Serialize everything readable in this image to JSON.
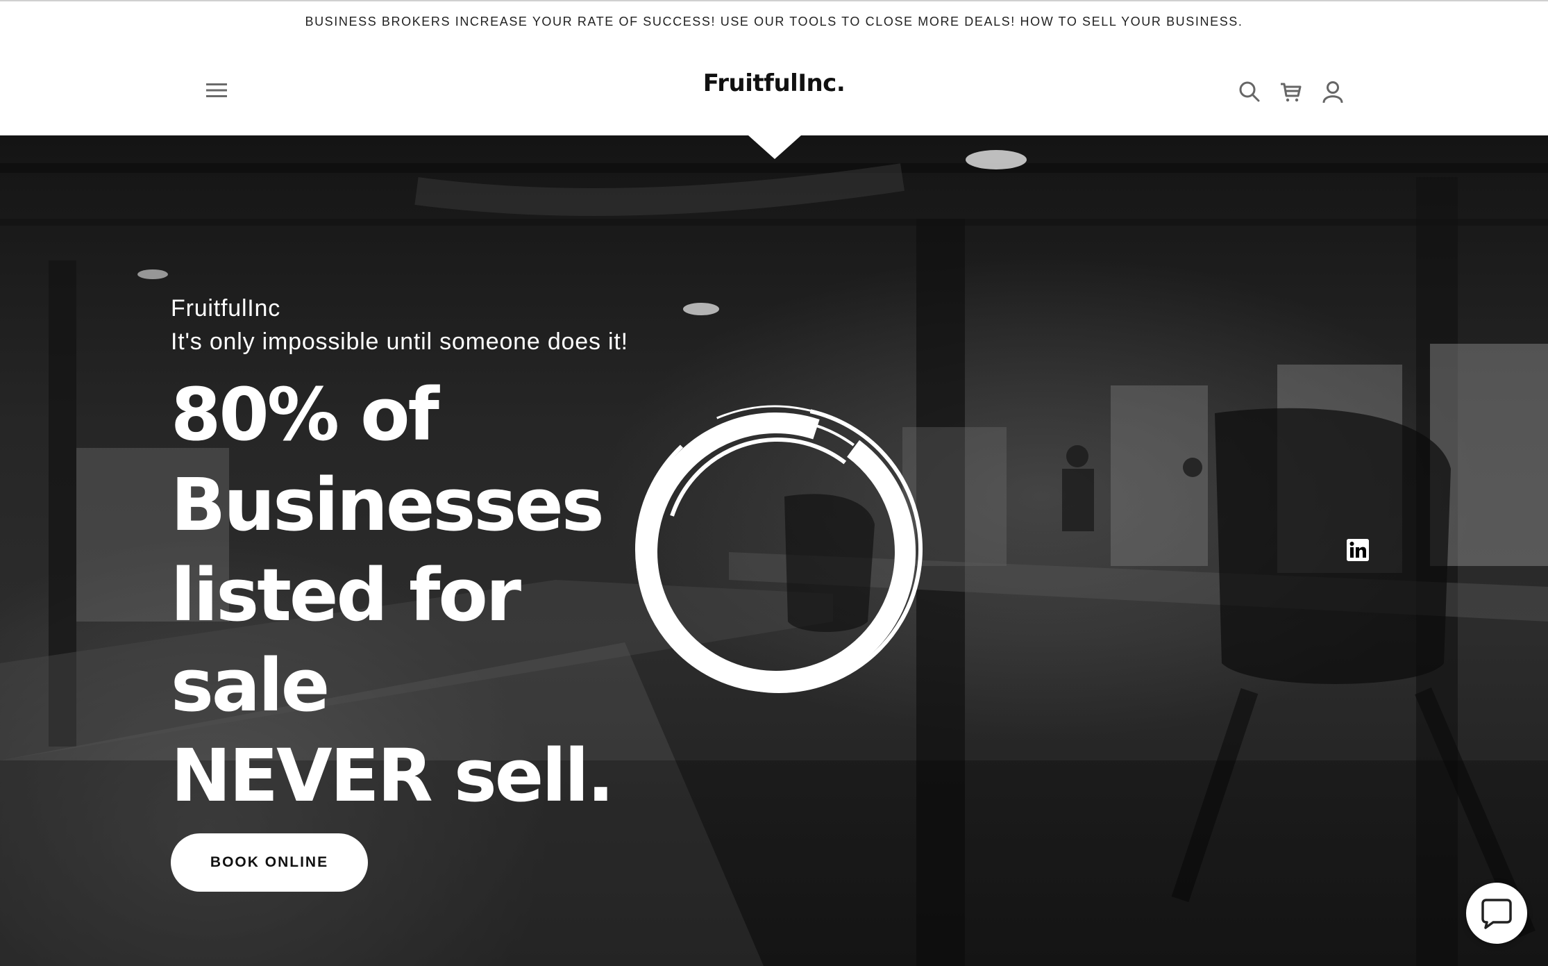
{
  "announcement": {
    "text": "BUSINESS BROKERS INCREASE YOUR RATE OF SUCCESS! USE OUR TOOLS TO CLOSE MORE DEALS! HOW TO SELL YOUR BUSINESS."
  },
  "header": {
    "logo": "FruitfulInc.",
    "icons": [
      "menu-icon",
      "search-icon",
      "cart-icon",
      "account-icon"
    ]
  },
  "hero": {
    "brand": "FruitfulInc",
    "tagline": "It's only impossible until someone does it!",
    "headline_lines": [
      "80% of",
      "Businesses",
      "listed for sale",
      "NEVER sell."
    ],
    "cta_label": "BOOK ONLINE",
    "social": [
      "linkedin-icon"
    ]
  },
  "chat": {
    "icon": "chat-icon"
  },
  "colors": {
    "text_dark": "#111111",
    "icon_gray": "#666666",
    "hero_overlay": "#1e1e1e",
    "white": "#ffffff"
  }
}
